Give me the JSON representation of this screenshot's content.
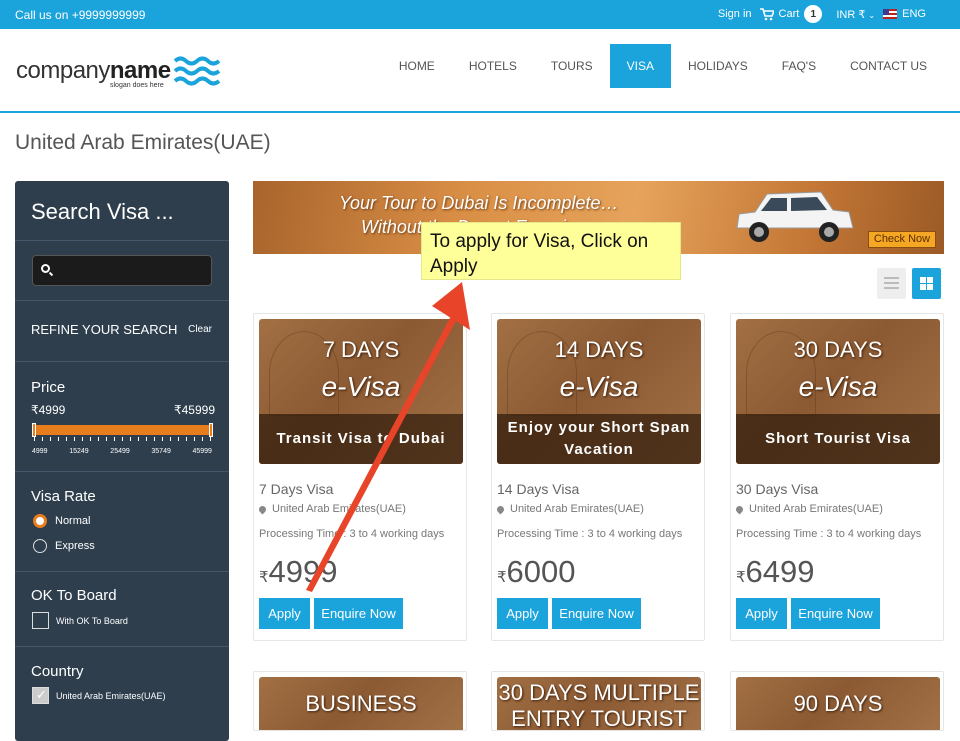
{
  "topbar": {
    "call_label": "Call us on +9999999999",
    "signin_label": "Sign in",
    "cart_label": "Cart",
    "cart_count": "1",
    "currency_label": "INR ₹",
    "language_label": "ENG"
  },
  "header": {
    "logo_word_1": "company",
    "logo_word_2": "name",
    "slogan": "slogan does here",
    "nav": [
      {
        "label": "HOME"
      },
      {
        "label": "HOTELS"
      },
      {
        "label": "TOURS"
      },
      {
        "label": "VISA"
      },
      {
        "label": "HOLIDAYS"
      },
      {
        "label": "FAQ'S"
      },
      {
        "label": "CONTACT US"
      }
    ],
    "active_nav": "VISA"
  },
  "page_title": "United Arab Emirates(UAE)",
  "sidebar": {
    "title": "Search Visa ...",
    "search_placeholder": "",
    "refine_label": "REFINE YOUR SEARCH",
    "clear_label": "Clear",
    "price_label": "Price",
    "price_min": "₹4999",
    "price_max": "₹45999",
    "price_scale": [
      "4999",
      "15249",
      "25499",
      "35749",
      "45999"
    ],
    "visa_rate_label": "Visa Rate",
    "visa_rate_options": [
      {
        "label": "Normal",
        "selected": true
      },
      {
        "label": "Express",
        "selected": false
      }
    ],
    "ok_to_board_label": "OK To Board",
    "ok_to_board_option": "With OK To Board",
    "country_label": "Country",
    "country_option": "United Arab Emirates(UAE)"
  },
  "banner": {
    "line1": "Your Tour to Dubai Is Incomplete…",
    "line2": "Without the Desert Experience",
    "cta": "Check Now"
  },
  "callout": "To apply for Visa, Click on Apply",
  "cards": [
    {
      "img_title": "7 DAYS",
      "img_subtitle": "e-Visa",
      "img_strip": "Transit Visa to Dubai",
      "name": "7 Days Visa",
      "location": "United Arab Emirates(UAE)",
      "processing": "Processing Time : 3 to 4 working days",
      "currency": "₹",
      "price": "4999",
      "apply_label": "Apply",
      "enquire_label": "Enquire Now"
    },
    {
      "img_title": "14 DAYS",
      "img_subtitle": "e-Visa",
      "img_strip": "Enjoy your Short Span Vacation",
      "name": "14 Days Visa",
      "location": "United Arab Emirates(UAE)",
      "processing": "Processing Time : 3 to 4 working days",
      "currency": "₹",
      "price": "6000",
      "apply_label": "Apply",
      "enquire_label": "Enquire Now"
    },
    {
      "img_title": "30 DAYS",
      "img_subtitle": "e-Visa",
      "img_strip": "Short Tourist Visa",
      "name": "30 Days Visa",
      "location": "United Arab Emirates(UAE)",
      "processing": "Processing Time : 3 to 4 working days",
      "currency": "₹",
      "price": "6499",
      "apply_label": "Apply",
      "enquire_label": "Enquire Now"
    }
  ],
  "more_cards": [
    {
      "img_title": "BUSINESS"
    },
    {
      "img_title": "30 DAYS MULTIPLE ENTRY TOURIST"
    },
    {
      "img_title": "90 DAYS"
    }
  ],
  "colors": {
    "accent": "#1ba3dc",
    "sidebar_bg": "#2e3e4d",
    "slider": "#e87d1e",
    "callout_bg": "#ffff99",
    "arrow": "#e8442a"
  },
  "icons": [
    "cart-icon",
    "flag-icon",
    "search-icon",
    "list-view-icon",
    "grid-view-icon",
    "location-pin-icon",
    "waves-logo-icon"
  ]
}
